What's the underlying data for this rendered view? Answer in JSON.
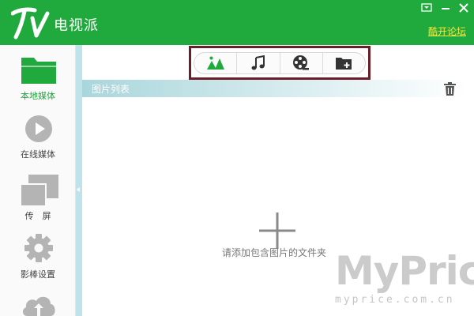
{
  "app": {
    "name": "电视派",
    "logo_text": "TV",
    "forum_link": "酷开论坛",
    "brand_color": "#20a93c"
  },
  "window_controls": [
    "dropdown-icon",
    "minimize-icon",
    "close-icon"
  ],
  "sidebar": {
    "items": [
      {
        "label": "本地媒体",
        "icon": "folder-icon",
        "active": true
      },
      {
        "label": "在线媒体",
        "icon": "play-circle-icon",
        "active": false
      },
      {
        "label": "传　屏",
        "icon": "screen-cast-icon",
        "active": false
      },
      {
        "label": "影棒设置",
        "icon": "gear-icon",
        "active": false
      },
      {
        "label": "",
        "icon": "cloud-upload-icon",
        "active": false
      }
    ]
  },
  "toolbar": {
    "buttons": [
      {
        "icon": "picture-icon",
        "selected": true
      },
      {
        "icon": "music-icon",
        "selected": false
      },
      {
        "icon": "film-reel-icon",
        "selected": false
      },
      {
        "icon": "add-folder-icon",
        "selected": false
      }
    ]
  },
  "list": {
    "title": "图片列表",
    "empty_hint": "请添加包含图片的文件夹"
  },
  "watermark": {
    "main": "MyPrice",
    "sub": "myprice.com.cn"
  }
}
